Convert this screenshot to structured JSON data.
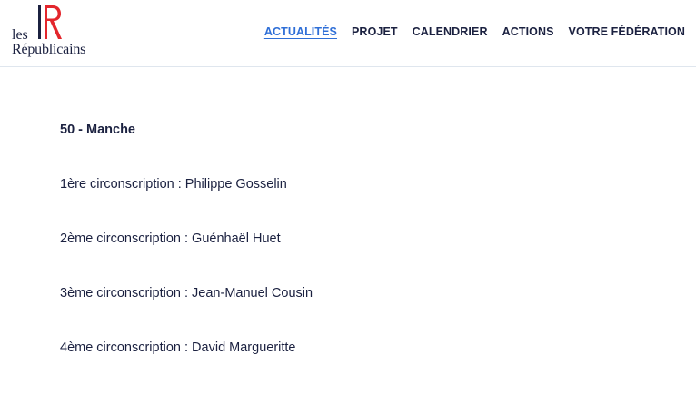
{
  "logo": {
    "line1": "les",
    "line2": "Républicains",
    "colors": {
      "blue": "#1b2140",
      "red": "#e3262c"
    }
  },
  "nav": {
    "items": [
      {
        "label": "ACTUALITÉS",
        "active": true
      },
      {
        "label": "PROJET"
      },
      {
        "label": "CALENDRIER"
      },
      {
        "label": "ACTIONS"
      },
      {
        "label": "VOTRE FÉDÉRATION"
      }
    ],
    "accent_color": "#2f6fd7"
  },
  "content": {
    "department": "50 - Manche",
    "circonscriptions": [
      "1ère circonscription : Philippe Gosselin",
      "2ème circonscription : Guénhaël Huet",
      "3ème circonscription : Jean-Manuel Cousin",
      "4ème circonscription : David Margueritte"
    ]
  }
}
